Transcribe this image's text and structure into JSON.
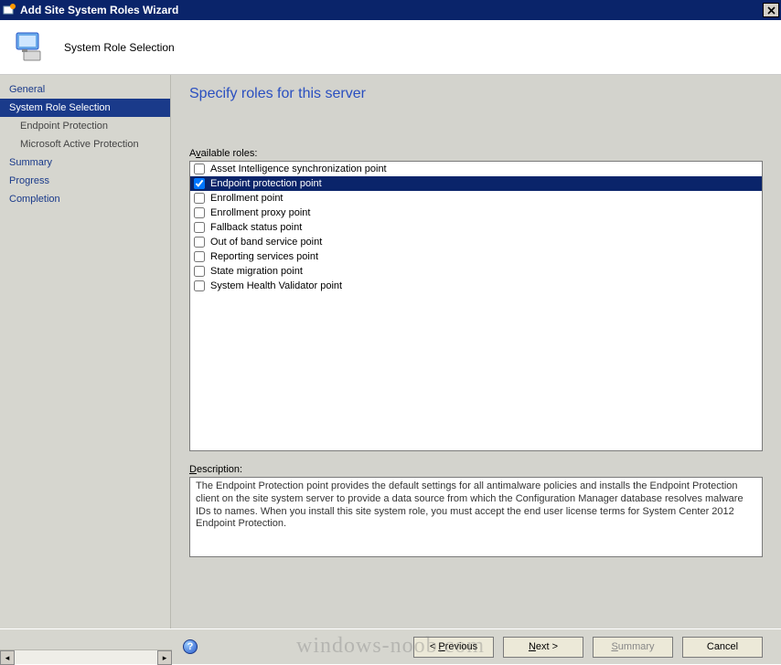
{
  "window": {
    "title": "Add Site System Roles Wizard",
    "close_icon": "close-icon"
  },
  "header": {
    "icon": "computer-monitor-icon",
    "title": "System Role Selection"
  },
  "sidebar": {
    "items": [
      {
        "label": "General",
        "selected": false,
        "sub": false
      },
      {
        "label": "System Role Selection",
        "selected": true,
        "sub": false
      },
      {
        "label": "Endpoint Protection",
        "selected": false,
        "sub": true
      },
      {
        "label": "Microsoft Active Protection",
        "selected": false,
        "sub": true
      },
      {
        "label": "Summary",
        "selected": false,
        "sub": false
      },
      {
        "label": "Progress",
        "selected": false,
        "sub": false
      },
      {
        "label": "Completion",
        "selected": false,
        "sub": false
      }
    ]
  },
  "content": {
    "heading": "Specify roles for this server",
    "available_label": "Available roles:",
    "roles": [
      {
        "label": "Asset Intelligence synchronization point",
        "checked": false,
        "selected": false
      },
      {
        "label": "Endpoint protection point",
        "checked": true,
        "selected": true
      },
      {
        "label": "Enrollment point",
        "checked": false,
        "selected": false
      },
      {
        "label": "Enrollment proxy point",
        "checked": false,
        "selected": false
      },
      {
        "label": "Fallback status point",
        "checked": false,
        "selected": false
      },
      {
        "label": "Out of band service point",
        "checked": false,
        "selected": false
      },
      {
        "label": "Reporting services point",
        "checked": false,
        "selected": false
      },
      {
        "label": "State migration point",
        "checked": false,
        "selected": false
      },
      {
        "label": "System Health Validator point",
        "checked": false,
        "selected": false
      }
    ],
    "description_label": "Description:",
    "description": "The Endpoint Protection point provides the default settings for all antimalware policies and installs the Endpoint Protection client on the site system server to provide a data source from which the Configuration Manager database resolves malware IDs to names. When you install this site system role, you must accept the end user license terms for System Center 2012 Endpoint Protection."
  },
  "buttons": {
    "help": "?",
    "previous": "< Previous",
    "next": "Next >",
    "summary": "Summary",
    "cancel": "Cancel",
    "summary_disabled": true
  },
  "watermark": "windows-noob.com"
}
